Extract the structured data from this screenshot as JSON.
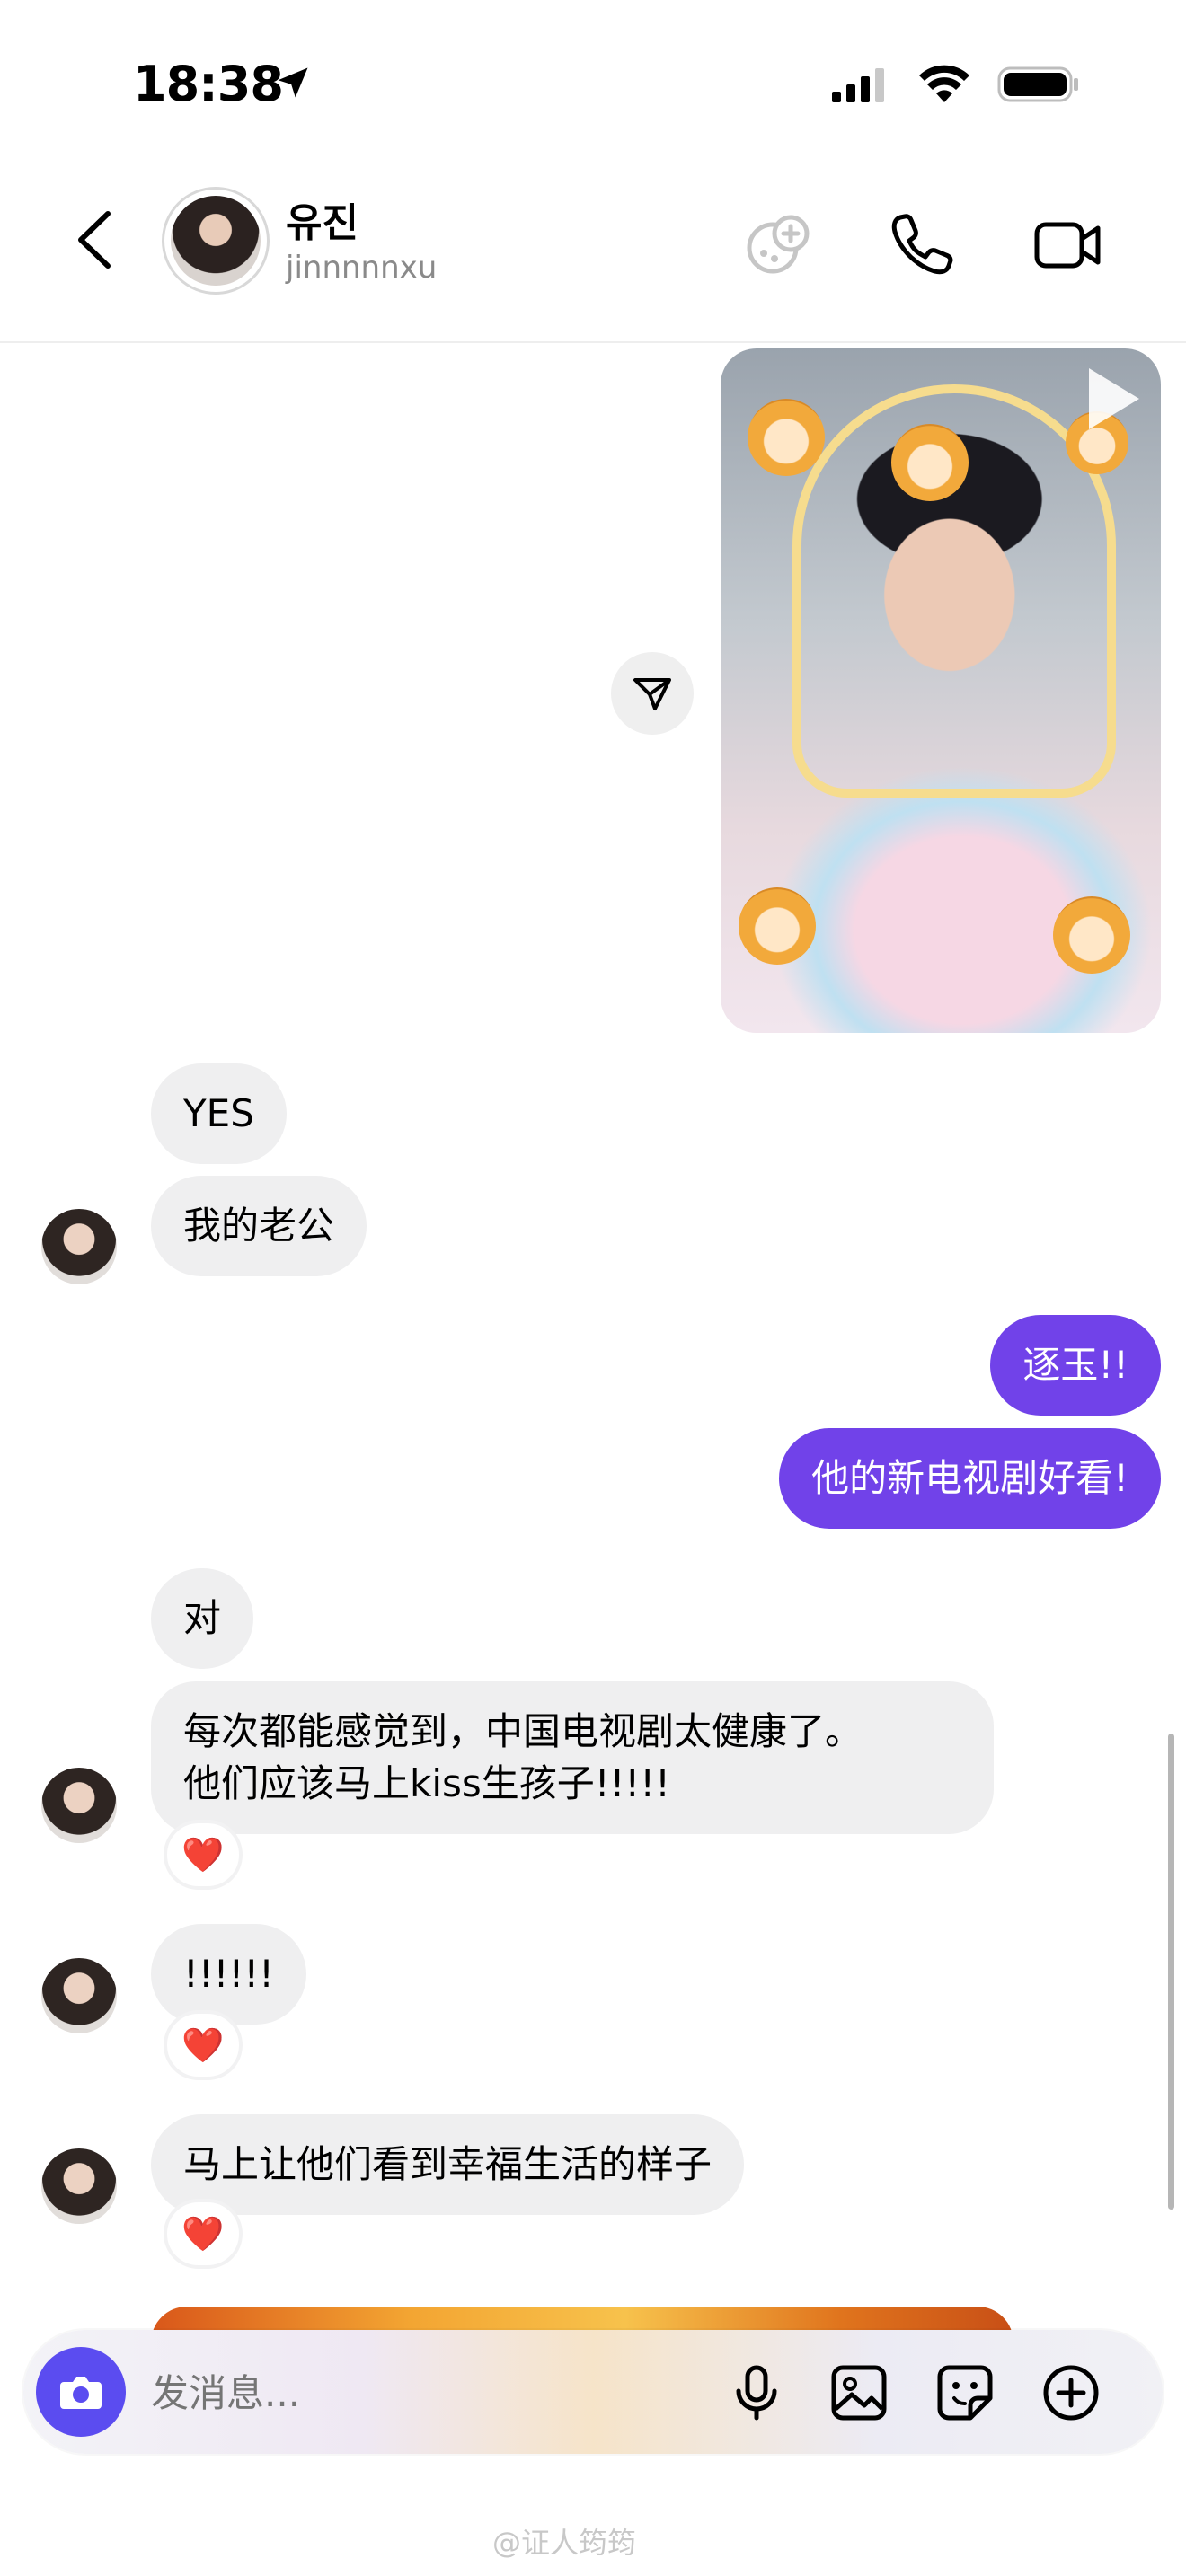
{
  "status_bar": {
    "time": "18:38"
  },
  "header": {
    "name": "유진",
    "username": "jinnnnnxu"
  },
  "messages": {
    "yes": "YES",
    "my_husband": "我的老公",
    "zhuyu": "逐玉!!",
    "good_drama": "他的新电视剧好看!",
    "dui": "对",
    "long_line1": "每次都能感觉到，中国电视剧太健康了。",
    "long_line2": "他们应该马上kiss生孩子!!!!!",
    "exclaim": "!!!!!!",
    "happy_life": "马上让他们看到幸福生活的样子"
  },
  "reaction_emoji": "❤️",
  "composer": {
    "placeholder": "发消息..."
  },
  "watermark": "@证人筠筠",
  "colors": {
    "outgoing": "#7142e9",
    "incoming": "#efeff0",
    "camera": "#5b4cf0"
  }
}
